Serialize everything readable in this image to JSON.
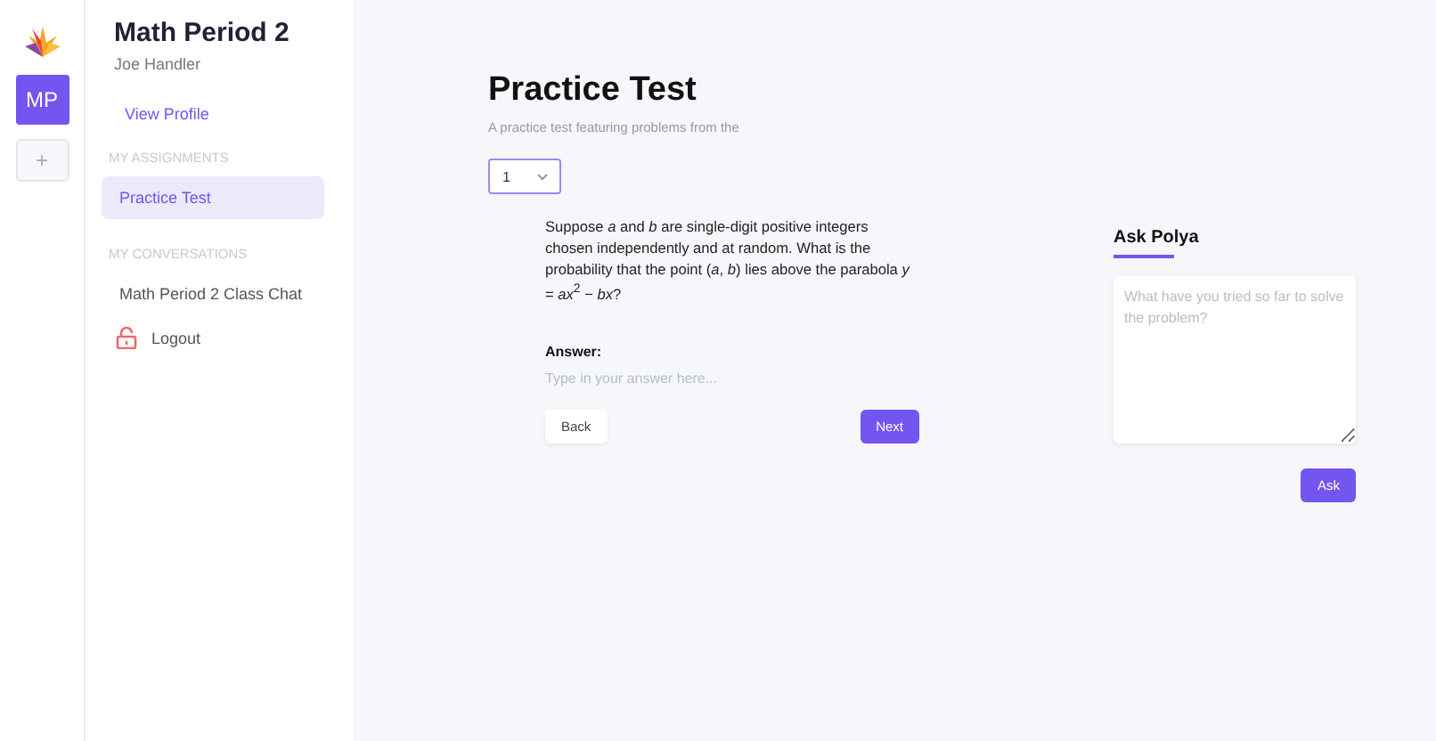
{
  "rail": {
    "class_badge": "MP",
    "add_button": "+"
  },
  "sidebar": {
    "title": "Math Period 2",
    "user": "Joe Handler",
    "profile_link": "View Profile",
    "sections": [
      {
        "heading": "MY ASSIGNMENTS",
        "items": [
          {
            "label": "Practice Test",
            "selected": true
          }
        ]
      },
      {
        "heading": "MY CONVERSATIONS",
        "items": [
          {
            "label": "Math Period 2 Class Chat",
            "selected": false
          }
        ]
      }
    ],
    "logout": "Logout"
  },
  "test": {
    "title": "Practice Test",
    "subtitle": "A practice test featuring problems from the",
    "question_select": "1",
    "question": "Suppose *a* and *b* are single-digit positive integers chosen independently and at random. What is the probability that the point (*a*, *b*) lies above the parabola *y* = *ax*$^{2}$ − *bx*?",
    "answer_label": "Answer:",
    "answer_placeholder": "Type in your answer here...",
    "buttons": [
      "Back",
      "Next"
    ]
  },
  "ask": {
    "title": "Ask Polya",
    "placeholder": "What have you tried so far to solve the problem?",
    "button": "Ask"
  }
}
